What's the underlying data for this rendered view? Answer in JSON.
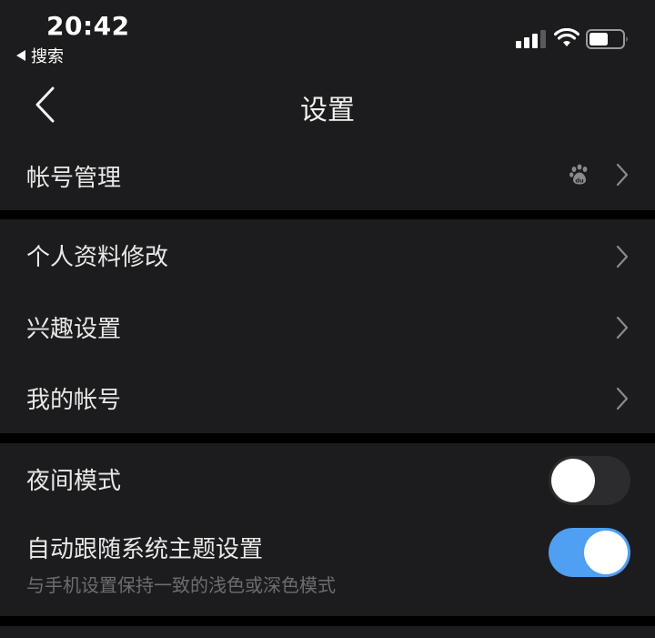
{
  "status_bar": {
    "time": "20:42",
    "back_app": "搜索"
  },
  "nav": {
    "title": "设置"
  },
  "account_group": {
    "items": [
      {
        "label": "帐号管理"
      }
    ]
  },
  "profile_group": {
    "items": [
      {
        "label": "个人资料修改"
      },
      {
        "label": "兴趣设置"
      },
      {
        "label": "我的帐号"
      }
    ]
  },
  "display_group": {
    "night_mode": {
      "label": "夜间模式",
      "enabled": false
    },
    "follow_system": {
      "label": "自动跟随系统主题设置",
      "sublabel": "与手机设置保持一致的浅色或深色模式",
      "enabled": true
    }
  },
  "colors": {
    "background": "#000000",
    "surface": "#1c1c1e",
    "toggle_on": "#4f9ff2",
    "toggle_off": "#2c2c2e"
  }
}
